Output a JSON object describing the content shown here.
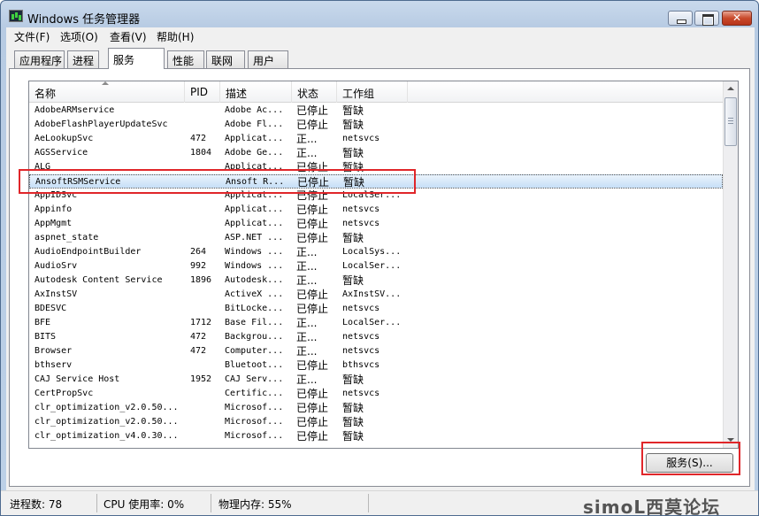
{
  "window": {
    "title": "Windows 任务管理器"
  },
  "menu": [
    "文件(F)",
    "选项(O)",
    "查看(V)",
    "帮助(H)"
  ],
  "tabs": [
    {
      "label": "应用程序",
      "active": false
    },
    {
      "label": "进程",
      "active": false
    },
    {
      "label": "服务",
      "active": true
    },
    {
      "label": "性能",
      "active": false
    },
    {
      "label": "联网",
      "active": false
    },
    {
      "label": "用户",
      "active": false
    }
  ],
  "columns": [
    "名称",
    "PID",
    "描述",
    "状态",
    "工作组"
  ],
  "services": [
    [
      "AdobeARMservice",
      "",
      "Adobe Ac...",
      "已停止",
      "暂缺"
    ],
    [
      "AdobeFlashPlayerUpdateSvc",
      "",
      "Adobe Fl...",
      "已停止",
      "暂缺"
    ],
    [
      "AeLookupSvc",
      "472",
      "Applicat...",
      "正...",
      "netsvcs"
    ],
    [
      "AGSService",
      "1804",
      "Adobe Ge...",
      "正...",
      "暂缺"
    ],
    [
      "ALG",
      "",
      "Applicat...",
      "已停止",
      "暂缺"
    ],
    [
      "AnsoftRSMService",
      "",
      "Ansoft R...",
      "已停止",
      "暂缺"
    ],
    [
      "AppIDSvc",
      "",
      "Applicat...",
      "已停止",
      "LocalSer..."
    ],
    [
      "Appinfo",
      "",
      "Applicat...",
      "已停止",
      "netsvcs"
    ],
    [
      "AppMgmt",
      "",
      "Applicat...",
      "已停止",
      "netsvcs"
    ],
    [
      "aspnet_state",
      "",
      "ASP.NET ...",
      "已停止",
      "暂缺"
    ],
    [
      "AudioEndpointBuilder",
      "264",
      "Windows ...",
      "正...",
      "LocalSys..."
    ],
    [
      "AudioSrv",
      "992",
      "Windows ...",
      "正...",
      "LocalSer..."
    ],
    [
      "Autodesk Content Service",
      "1896",
      "Autodesk...",
      "正...",
      "暂缺"
    ],
    [
      "AxInstSV",
      "",
      "ActiveX ...",
      "已停止",
      "AxInstSV..."
    ],
    [
      "BDESVC",
      "",
      "BitLocke...",
      "已停止",
      "netsvcs"
    ],
    [
      "BFE",
      "1712",
      "Base Fil...",
      "正...",
      "LocalSer..."
    ],
    [
      "BITS",
      "472",
      "Backgrou...",
      "正...",
      "netsvcs"
    ],
    [
      "Browser",
      "472",
      "Computer...",
      "正...",
      "netsvcs"
    ],
    [
      "bthserv",
      "",
      "Bluetoot...",
      "已停止",
      "bthsvcs"
    ],
    [
      "CAJ Service Host",
      "1952",
      "CAJ Serv...",
      "正...",
      "暂缺"
    ],
    [
      "CertPropSvc",
      "",
      "Certific...",
      "已停止",
      "netsvcs"
    ],
    [
      "clr_optimization_v2.0.50...",
      "",
      "Microsof...",
      "已停止",
      "暂缺"
    ],
    [
      "clr_optimization_v2.0.50...",
      "",
      "Microsof...",
      "已停止",
      "暂缺"
    ],
    [
      "clr_optimization_v4.0.30...",
      "",
      "Microsof...",
      "已停止",
      "暂缺"
    ]
  ],
  "selected_service": "AnsoftRSMService",
  "services_button": "服务(S)...",
  "status": {
    "processes": "进程数: 78",
    "cpu": "CPU 使用率: 0%",
    "memory": "物理内存: 55%"
  },
  "watermark": "simoL西莫论坛",
  "colors": {
    "highlight": "#e0262a",
    "selection": "#c6dff7"
  }
}
